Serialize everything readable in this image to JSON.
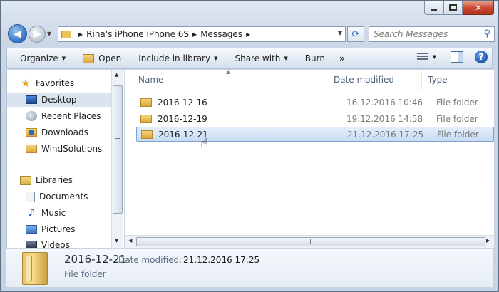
{
  "window": {
    "minimize_label": "",
    "maximize_label": "",
    "close_label": "✕"
  },
  "address": {
    "crumbs": [
      "Rina's iPhone iPhone 6S",
      "Messages"
    ]
  },
  "search": {
    "placeholder": "Search Messages"
  },
  "toolbar": {
    "organize": "Organize",
    "open": "Open",
    "include_in_library": "Include in library",
    "share_with": "Share with",
    "burn": "Burn",
    "more": "»"
  },
  "sidebar": {
    "favorites": "Favorites",
    "desktop": "Desktop",
    "recent_places": "Recent Places",
    "downloads": "Downloads",
    "windsolutions": "WindSolutions",
    "libraries": "Libraries",
    "documents": "Documents",
    "music": "Music",
    "pictures": "Pictures",
    "videos": "Videos"
  },
  "columns": {
    "name": "Name",
    "date_modified": "Date modified",
    "type": "Type"
  },
  "files": [
    {
      "name": "2016-12-16",
      "date": "16.12.2016 10:46",
      "type": "File folder"
    },
    {
      "name": "2016-12-19",
      "date": "19.12.2016 14:58",
      "type": "File folder"
    },
    {
      "name": "2016-12-21",
      "date": "21.12.2016 17:25",
      "type": "File folder"
    }
  ],
  "details": {
    "name": "2016-12-21",
    "date_label": "Date modified:",
    "date_value": "21.12.2016 17:25",
    "type": "File folder"
  },
  "colors": {
    "accent": "#2b6bc0",
    "selection": "#c9dcf4",
    "close": "#c8472e"
  }
}
